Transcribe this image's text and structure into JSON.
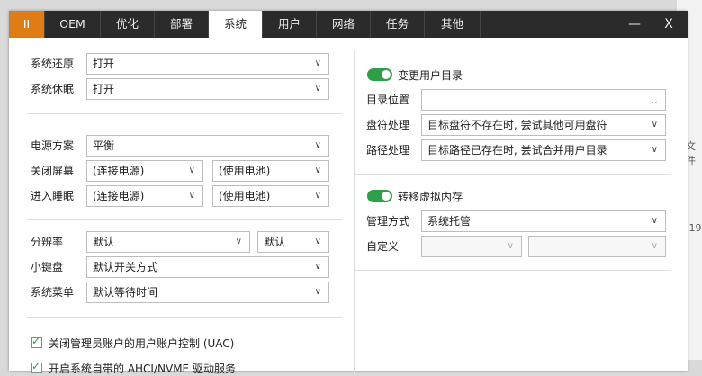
{
  "tabs": [
    {
      "label": "II"
    },
    {
      "label": "OEM"
    },
    {
      "label": "优化"
    },
    {
      "label": "部署"
    },
    {
      "label": "系统"
    },
    {
      "label": "用户"
    },
    {
      "label": "网络"
    },
    {
      "label": "任务"
    },
    {
      "label": "其他"
    }
  ],
  "window_controls": {
    "minimize": "—",
    "close": "X"
  },
  "left": {
    "system_restore": {
      "label": "系统还原",
      "value": "打开"
    },
    "system_sleep": {
      "label": "系统休眠",
      "value": "打开"
    },
    "power_plan": {
      "label": "电源方案",
      "value": "平衡"
    },
    "screen_off": {
      "label": "关闭屏幕",
      "ac": "(连接电源)",
      "dc": "(使用电池)"
    },
    "enter_sleep": {
      "label": "进入睡眠",
      "ac": "(连接电源)",
      "dc": "(使用电池)"
    },
    "resolution": {
      "label": "分辨率",
      "value": "默认",
      "value2": "默认"
    },
    "small_keyboard": {
      "label": "小键盘",
      "value": "默认开关方式"
    },
    "system_menu": {
      "label": "系统菜单",
      "value": "默认等待时间"
    },
    "checks": [
      {
        "label": "关闭管理员账户的用户账户控制 (UAC)",
        "checked": true
      },
      {
        "label": "开启系统自带的 AHCI/NVME 驱动服务",
        "checked": true
      }
    ]
  },
  "right": {
    "change_user_dir": {
      "label": "变更用户目录",
      "on": true
    },
    "dir_location": {
      "label": "目录位置",
      "value": "",
      "browse": ".."
    },
    "drive_handling": {
      "label": "盘符处理",
      "value": "目标盘符不存在时, 尝试其他可用盘符"
    },
    "path_handling": {
      "label": "路径处理",
      "value": "目标路径已存在时, 尝试合并用户目录"
    },
    "move_vm": {
      "label": "转移虚拟内存",
      "on": true
    },
    "manage_mode": {
      "label": "管理方式",
      "value": "系统托管"
    },
    "custom": {
      "label": "自定义",
      "value": "",
      "value2": ""
    }
  },
  "background": {
    "text1": "文件",
    "text2": ".19"
  },
  "colors": {
    "accent_orange": "#e07c16",
    "toggle_green": "#2e9e47",
    "titlebar": "#2b2b2b"
  }
}
